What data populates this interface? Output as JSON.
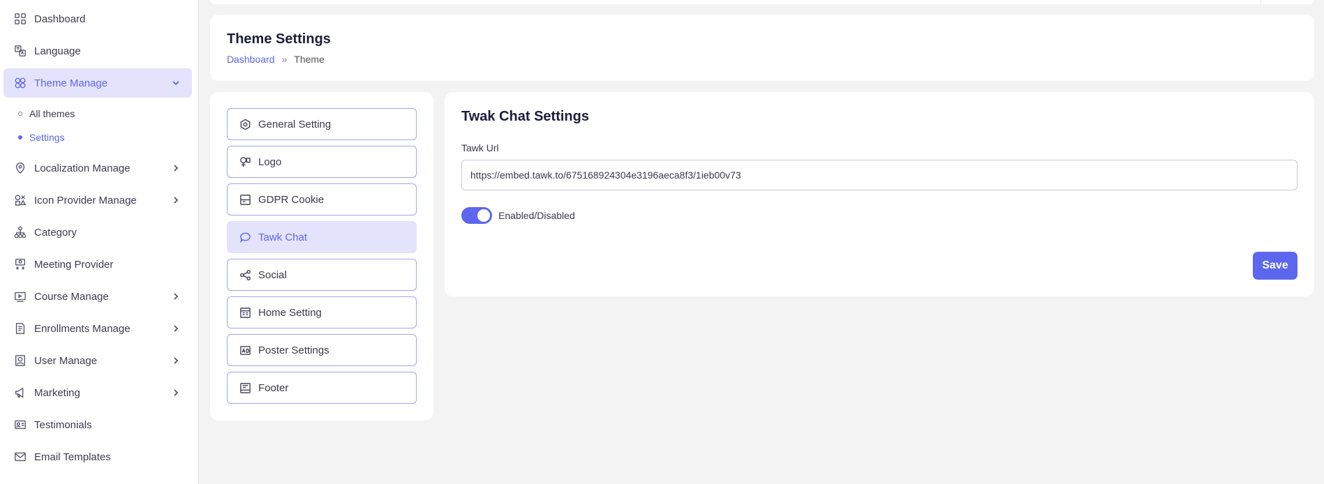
{
  "sidebar": {
    "items": [
      {
        "label": "Dashboard",
        "icon": "grid-icon"
      },
      {
        "label": "Language",
        "icon": "translate-icon"
      },
      {
        "label": "Theme Manage",
        "icon": "theme-icon"
      },
      {
        "label": "Localization Manage",
        "icon": "map-pin-icon"
      },
      {
        "label": "Icon Provider Manage",
        "icon": "shapes-icon"
      },
      {
        "label": "Category",
        "icon": "hierarchy-icon"
      },
      {
        "label": "Meeting Provider",
        "icon": "meeting-icon"
      },
      {
        "label": "Course Manage",
        "icon": "video-icon"
      },
      {
        "label": "Enrollments Manage",
        "icon": "document-icon"
      },
      {
        "label": "User Manage",
        "icon": "user-icon"
      },
      {
        "label": "Marketing",
        "icon": "megaphone-icon"
      },
      {
        "label": "Testimonials",
        "icon": "id-card-icon"
      },
      {
        "label": "Email Templates",
        "icon": "mail-icon"
      }
    ],
    "theme_sub": [
      {
        "label": "All themes"
      },
      {
        "label": "Settings"
      }
    ]
  },
  "header": {
    "title": "Theme Settings",
    "breadcrumb_link": "Dashboard",
    "breadcrumb_sep": "»",
    "breadcrumb_current": "Theme"
  },
  "menu": {
    "items": [
      {
        "label": "General Setting",
        "icon": "settings-hex-icon"
      },
      {
        "label": "Logo",
        "icon": "logo-icon"
      },
      {
        "label": "GDPR Cookie",
        "icon": "cookie-icon"
      },
      {
        "label": "Tawk Chat",
        "icon": "chat-icon"
      },
      {
        "label": "Social",
        "icon": "share-icon"
      },
      {
        "label": "Home Setting",
        "icon": "layout-icon"
      },
      {
        "label": "Poster Settings",
        "icon": "ad-icon"
      },
      {
        "label": "Footer",
        "icon": "footer-icon"
      }
    ]
  },
  "settings": {
    "title": "Twak Chat Settings",
    "url_label": "Tawk Url",
    "url_value": "https://embed.tawk.to/675168924304e3196aeca8f3/1ieb00v73",
    "toggle_label": "Enabled/Disabled",
    "toggle_on": true,
    "save_label": "Save"
  },
  "colors": {
    "accent": "#5c67ee",
    "active_bg": "#e3e3fb"
  }
}
